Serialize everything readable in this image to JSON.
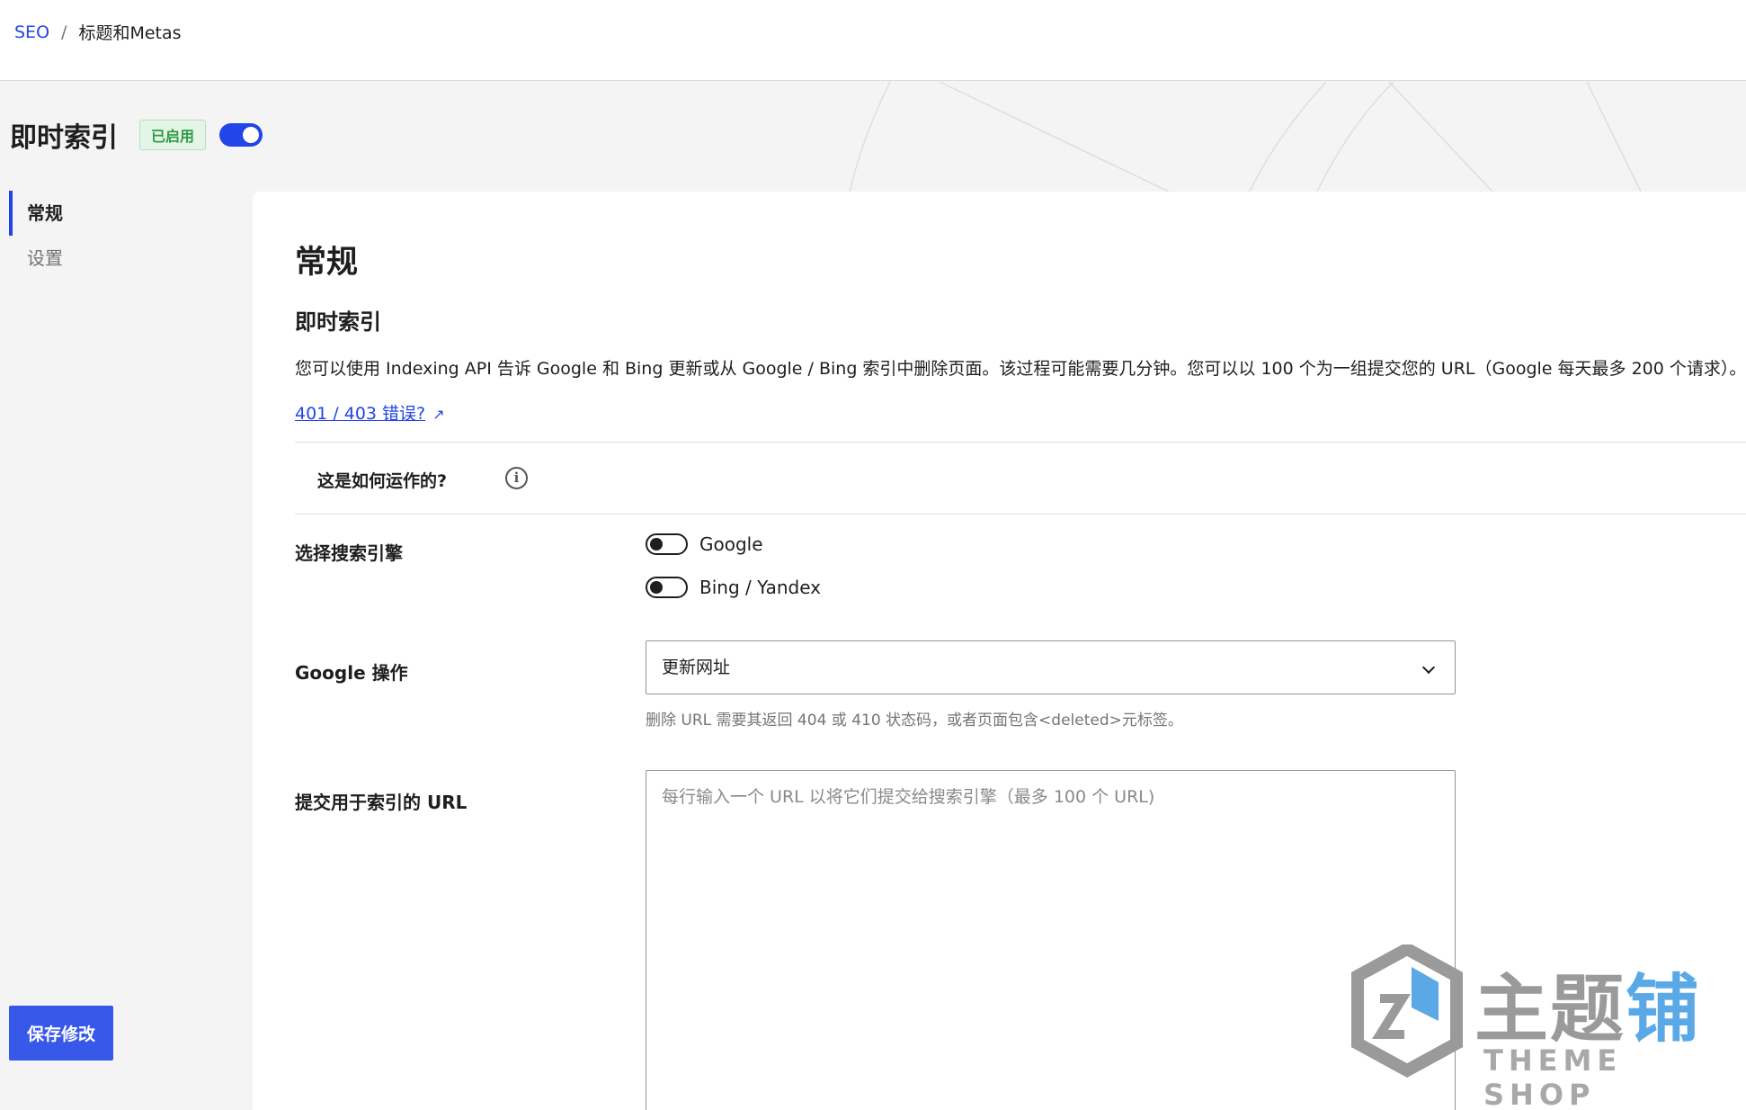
{
  "breadcrumb": {
    "root": "SEO",
    "separator": "/",
    "current": "标题和Metas"
  },
  "header": {
    "title": "即时索引",
    "status_badge": "已启用",
    "enabled": true
  },
  "sidebar": {
    "items": [
      {
        "label": "常规",
        "active": true
      },
      {
        "label": "设置",
        "active": false
      }
    ]
  },
  "save_button": "保存修改",
  "content": {
    "section_title": "常规",
    "subsection_title": "即时索引",
    "description": "您可以使用 Indexing API 告诉 Google 和 Bing 更新或从 Google / Bing 索引中删除页面。该过程可能需要几分钟。您可以以 100 个为一组提交您的 URL（Google 每天最多 200 个请求）。",
    "help_link": "401 / 403 错误?",
    "how_it_works": "这是如何运作的?"
  },
  "fields": {
    "engines": {
      "label": "选择搜索引擎",
      "options": [
        {
          "label": "Google",
          "enabled": false
        },
        {
          "label": "Bing / Yandex",
          "enabled": false
        }
      ]
    },
    "google_action": {
      "label": "Google 操作",
      "value": "更新网址",
      "hint": "删除 URL 需要其返回 404 或 410 状态码，或者页面包含<deleted>元标签。"
    },
    "urls": {
      "label": "提交用于索引的 URL",
      "value": "",
      "placeholder": "每行输入一个 URL 以将它们提交给搜索引擎（最多 100 个 URL)"
    }
  },
  "watermark": {
    "brand_a": "主题",
    "brand_b": "铺",
    "sub": "THEME SHOP"
  },
  "colors": {
    "accent": "#2145e6",
    "button": "#3858e9",
    "badge_bg": "#e4f5e7",
    "badge_text": "#2f9a43"
  }
}
